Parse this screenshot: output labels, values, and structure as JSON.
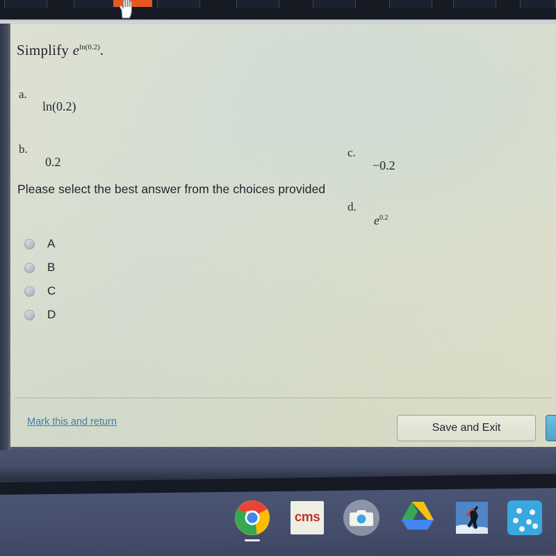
{
  "browser": {
    "active_tab_icon": "orange-favicon",
    "cursor": "pointing-hand-cursor"
  },
  "quiz": {
    "question_prefix": "Simplify",
    "question_base": "e",
    "question_exponent": "ln(0.2)",
    "question_suffix": ".",
    "choices": [
      {
        "label": "a.",
        "text": "ln(0.2)"
      },
      {
        "label": "b.",
        "text": "0.2"
      },
      {
        "label": "c.",
        "text": "−0.2"
      },
      {
        "label": "d.",
        "base": "e",
        "exponent": "0.2"
      }
    ],
    "instruction": "Please select the best answer from the choices provided",
    "options": [
      {
        "letter": "A",
        "selected": false
      },
      {
        "letter": "B",
        "selected": false
      },
      {
        "letter": "C",
        "selected": false
      },
      {
        "letter": "D",
        "selected": false
      }
    ],
    "footer": {
      "mark_link": "Mark this and return",
      "save_exit_label": "Save and Exit",
      "next_button": "next-button-partial"
    }
  },
  "taskbar": {
    "items": [
      {
        "name": "chrome-icon",
        "active": true
      },
      {
        "name": "cms-icon",
        "text": "cms"
      },
      {
        "name": "camera-icon"
      },
      {
        "name": "google-drive-icon"
      },
      {
        "name": "superhero-app-icon"
      },
      {
        "name": "blue-dots-app-icon"
      }
    ]
  },
  "colors": {
    "link": "#3d7fa8",
    "accent_orange": "#e8561f",
    "next_button": "#4da3c7",
    "page_bg": "#e3e5d4",
    "shelf": "#4a5473"
  }
}
